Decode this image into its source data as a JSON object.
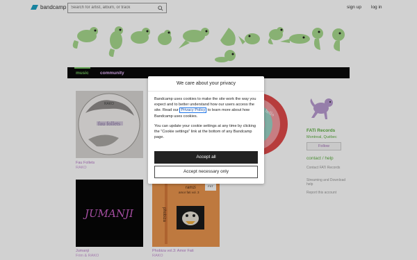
{
  "topnav": {
    "logo_text": "bandcamp",
    "search_placeholder": "Search for artist, album, or track",
    "signup": "sign up",
    "login": "log in"
  },
  "band_nav": {
    "music": "music",
    "community": "community"
  },
  "albums": [
    {
      "title": "Fau Follets",
      "artist": "RAKO"
    },
    {
      "title": "",
      "artist": ""
    },
    {
      "title": "Jumanji",
      "artist": "Frim & RAKO"
    },
    {
      "title": "Phobiza vol.3: Amor Fati",
      "artist": "RAKO"
    }
  ],
  "cover_texts": {
    "fau_follets": "fau follets",
    "fau_follets_sub": "RAKO",
    "jumanji": "JUMANJI",
    "phobiza_top": "ramzi",
    "phobiza_sub": "phobiza",
    "phobiza_line": "amor fati vol. 3",
    "phobiza_badge": "FXT\nRAKO"
  },
  "sidebar": {
    "label_name": "FATi Records",
    "location": "Montreal, Québec",
    "follow": "Follow",
    "contact": "contact / help",
    "links": [
      "Contact FATi Records",
      "Streaming and Download help",
      "Report this account"
    ]
  },
  "modal": {
    "title": "We care about your privacy",
    "para1_pre": "Bandcamp uses cookies to make the site work the way you expect and to better understand how our users access the site. Read our ",
    "privacy_link": "Privacy Policy",
    "para1_post": " to learn more about how Bandcamp uses cookies.",
    "para2": "You can update your cookie settings at any time by clicking the “Cookie settings” link at the bottom of any Bandcamp page.",
    "accept_all": "Accept all",
    "accept_necessary": "Accept necessary only"
  },
  "colors": {
    "logo": "#1da0c3",
    "music_tab": "#72c25e",
    "community_tab": "#e9b8ff",
    "label_green": "#5cae41",
    "link_purple": "#b479c6",
    "header_critters": "#a7d88d"
  }
}
